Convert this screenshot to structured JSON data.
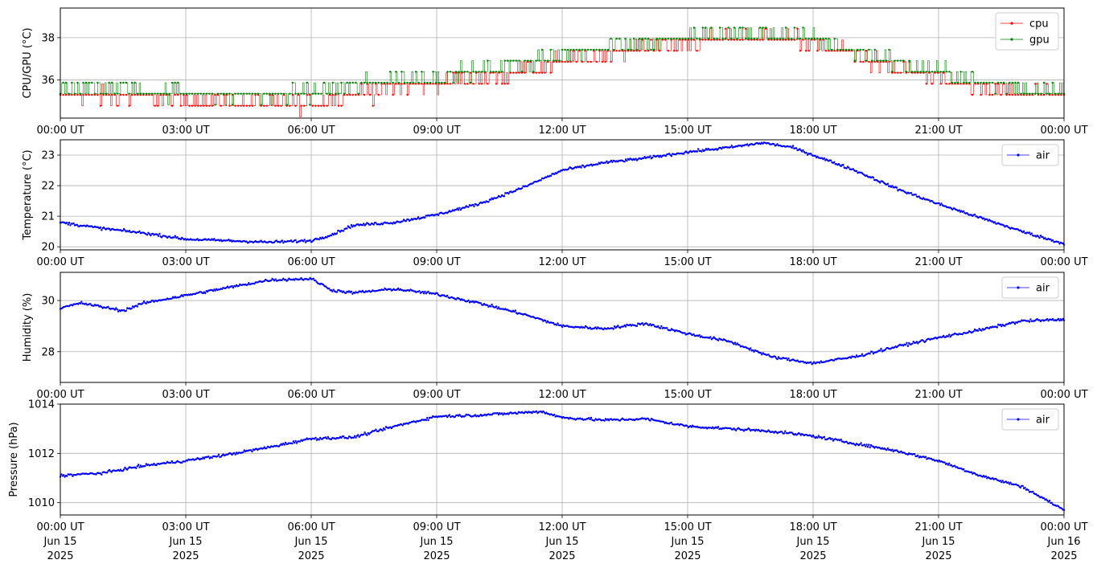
{
  "chart_data": [
    {
      "type": "line",
      "ylabel": "CPU/GPU (°C)",
      "xlim_hours": [
        0,
        24
      ],
      "ylim": [
        34.2,
        39.4
      ],
      "yticks": [
        36,
        38
      ],
      "x_ticks": [
        "00:00 UT",
        "03:00 UT",
        "06:00 UT",
        "09:00 UT",
        "12:00 UT",
        "15:00 UT",
        "18:00 UT",
        "21:00 UT",
        "00:00 UT"
      ],
      "grid": true,
      "legend_position": "top-right",
      "series": [
        {
          "name": "cpu",
          "color": "#ff0000",
          "hours": [
            0,
            1,
            2,
            3,
            4,
            5,
            6,
            7,
            8,
            9,
            10,
            11,
            12,
            13,
            14,
            15,
            16,
            17,
            18,
            19,
            20,
            21,
            22,
            23,
            24
          ],
          "values": [
            35.4,
            35.3,
            35.2,
            35.1,
            35.0,
            34.9,
            35.0,
            35.4,
            35.7,
            35.9,
            36.1,
            36.5,
            36.9,
            37.3,
            37.6,
            37.8,
            38.0,
            38.1,
            37.8,
            37.2,
            36.6,
            36.1,
            35.7,
            35.4,
            35.3
          ]
        },
        {
          "name": "gpu",
          "color": "#008000",
          "hours": [
            0,
            1,
            2,
            3,
            4,
            5,
            6,
            7,
            8,
            9,
            10,
            11,
            12,
            13,
            14,
            15,
            16,
            17,
            18,
            19,
            20,
            21,
            22,
            23,
            24
          ],
          "values": [
            35.7,
            35.6,
            35.5,
            35.4,
            35.3,
            35.3,
            35.4,
            35.7,
            36.0,
            36.2,
            36.4,
            36.8,
            37.2,
            37.6,
            37.8,
            38.0,
            38.2,
            38.2,
            38.0,
            37.4,
            36.8,
            36.3,
            35.9,
            35.6,
            35.5
          ]
        }
      ]
    },
    {
      "type": "line",
      "ylabel": "Temperature (°C)",
      "xlim_hours": [
        0,
        24
      ],
      "ylim": [
        19.9,
        23.5
      ],
      "yticks": [
        20,
        21,
        22,
        23
      ],
      "x_ticks": [
        "00:00 UT",
        "03:00 UT",
        "06:00 UT",
        "09:00 UT",
        "12:00 UT",
        "15:00 UT",
        "18:00 UT",
        "21:00 UT",
        "00:00 UT"
      ],
      "grid": true,
      "legend_position": "top-right",
      "series": [
        {
          "name": "air",
          "color": "#0000ff",
          "hours": [
            0,
            1,
            2,
            3,
            4,
            5,
            6,
            6.5,
            7,
            8,
            9,
            10,
            11,
            12,
            13,
            14,
            15,
            16,
            16.8,
            17.5,
            18,
            19,
            20,
            21,
            22,
            23,
            24
          ],
          "values": [
            20.8,
            20.6,
            20.45,
            20.25,
            20.2,
            20.15,
            20.2,
            20.4,
            20.7,
            20.8,
            21.05,
            21.4,
            21.9,
            22.5,
            22.75,
            22.9,
            23.1,
            23.25,
            23.4,
            23.25,
            23.0,
            22.5,
            21.9,
            21.4,
            20.95,
            20.5,
            20.1
          ]
        }
      ]
    },
    {
      "type": "line",
      "ylabel": "Humidity (%)",
      "xlim_hours": [
        0,
        24
      ],
      "ylim": [
        26.8,
        31.1
      ],
      "yticks": [
        28,
        30
      ],
      "x_ticks": [
        "00:00 UT",
        "03:00 UT",
        "06:00 UT",
        "09:00 UT",
        "12:00 UT",
        "15:00 UT",
        "18:00 UT",
        "21:00 UT",
        "00:00 UT"
      ],
      "grid": true,
      "legend_position": "top-right",
      "series": [
        {
          "name": "air",
          "color": "#0000ff",
          "hours": [
            0,
            0.5,
            1,
            1.5,
            2,
            3,
            4,
            5,
            6,
            6.5,
            7,
            8,
            9,
            10,
            11,
            12,
            13,
            14,
            15,
            16,
            17,
            18,
            19,
            20,
            21,
            22,
            23,
            24
          ],
          "values": [
            29.7,
            29.9,
            29.75,
            29.6,
            29.9,
            30.2,
            30.5,
            30.8,
            30.85,
            30.4,
            30.3,
            30.45,
            30.25,
            29.9,
            29.5,
            29.0,
            28.9,
            29.1,
            28.7,
            28.4,
            27.8,
            27.55,
            27.8,
            28.2,
            28.55,
            28.85,
            29.2,
            29.25
          ]
        }
      ]
    },
    {
      "type": "line",
      "ylabel": "Pressure (hPa)",
      "xlim_hours": [
        0,
        24
      ],
      "ylim": [
        1009.5,
        1014.0
      ],
      "yticks": [
        1010,
        1012,
        1014
      ],
      "x_ticks": [
        "00:00 UT",
        "03:00 UT",
        "06:00 UT",
        "09:00 UT",
        "12:00 UT",
        "15:00 UT",
        "18:00 UT",
        "21:00 UT",
        "00:00 UT"
      ],
      "x_ticks_date": [
        "Jun 15",
        "Jun 15",
        "Jun 15",
        "Jun 15",
        "Jun 15",
        "Jun 15",
        "Jun 15",
        "Jun 15",
        "Jun 16"
      ],
      "x_ticks_year": [
        "2025",
        "2025",
        "2025",
        "2025",
        "2025",
        "2025",
        "2025",
        "2025",
        "2025"
      ],
      "grid": true,
      "legend_position": "top-right",
      "series": [
        {
          "name": "air",
          "color": "#0000ff",
          "hours": [
            0,
            1,
            2,
            3,
            4,
            5,
            6,
            7,
            8,
            9,
            10,
            11,
            11.5,
            12,
            13,
            14,
            15,
            16,
            17,
            18,
            19,
            20,
            21,
            22,
            23,
            24
          ],
          "values": [
            1011.1,
            1011.2,
            1011.5,
            1011.7,
            1011.95,
            1012.25,
            1012.6,
            1012.65,
            1013.1,
            1013.5,
            1013.55,
            1013.65,
            1013.7,
            1013.45,
            1013.35,
            1013.4,
            1013.1,
            1013.0,
            1012.9,
            1012.7,
            1012.4,
            1012.1,
            1011.7,
            1011.1,
            1010.65,
            1009.7
          ]
        }
      ]
    }
  ]
}
